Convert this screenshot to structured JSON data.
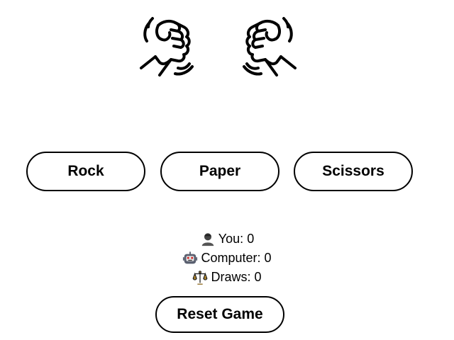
{
  "hands": {
    "player_icon": "raised-fist-icon",
    "computer_icon": "raised-fist-icon"
  },
  "choices": {
    "rock_label": "Rock",
    "paper_label": "Paper",
    "scissors_label": "Scissors"
  },
  "scores": {
    "you_label": "You:",
    "you_value": "0",
    "computer_label": "Computer:",
    "computer_value": "0",
    "draws_label": "Draws:",
    "draws_value": "0",
    "you_icon": "person-icon",
    "computer_icon": "robot-icon",
    "draws_icon": "balance-scale-icon"
  },
  "reset": {
    "label": "Reset Game"
  }
}
